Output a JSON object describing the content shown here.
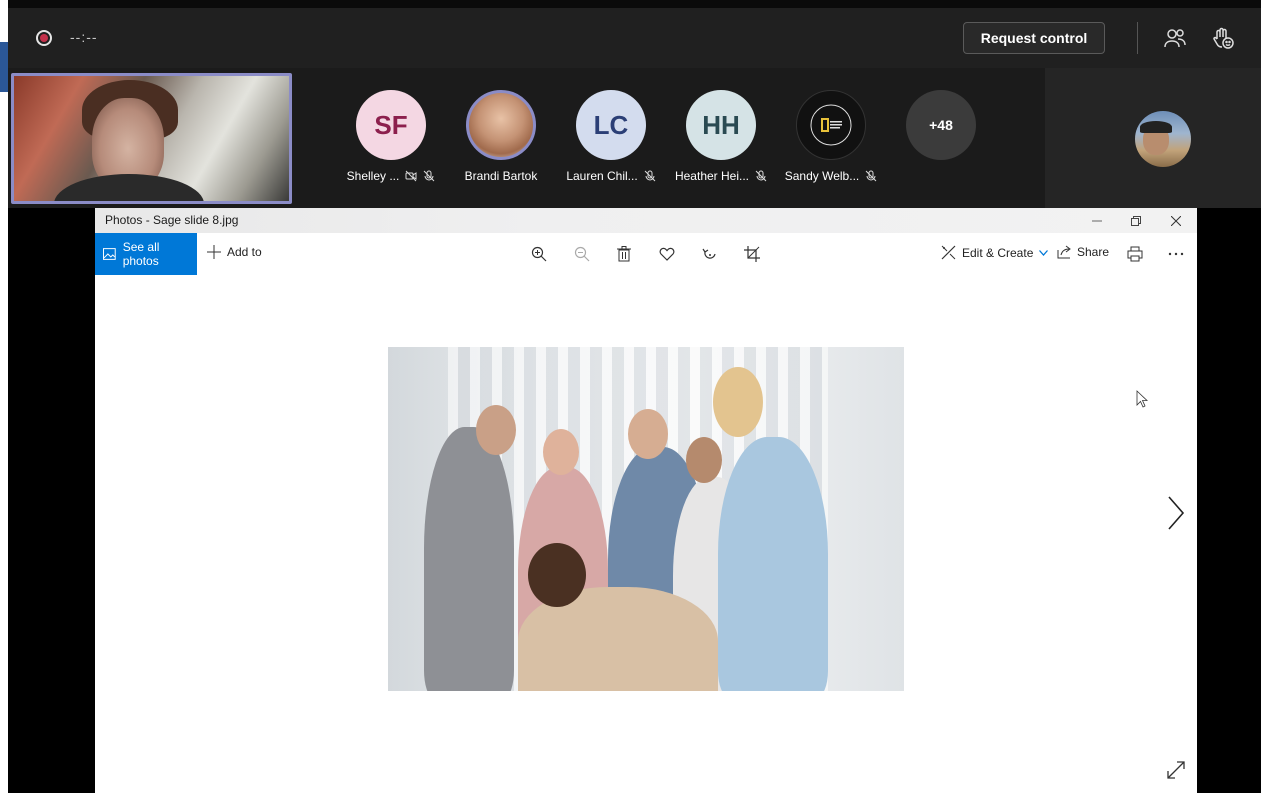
{
  "meeting": {
    "timer": "--:--",
    "request_control_label": "Request control",
    "participants": [
      {
        "initials": "SF",
        "name": "Shelley ...",
        "avatar_color": "#f4d7e3",
        "text_color": "#8c1f4d"
      },
      {
        "initials": "",
        "name": "Brandi Bartok",
        "avatar_color": "#c9a58a",
        "text_color": "#ffffff"
      },
      {
        "initials": "LC",
        "name": "Lauren Chil...",
        "avatar_color": "#d3dcee",
        "text_color": "#2b3f76"
      },
      {
        "initials": "HH",
        "name": "Heather Hei...",
        "avatar_color": "#d5e3e6",
        "text_color": "#2a4a52"
      },
      {
        "initials": "",
        "name": "Sandy Welb...",
        "avatar_color": "#111111",
        "text_color": "#ffffff"
      }
    ],
    "more_count": "+48"
  },
  "photos": {
    "window_title": "Photos - Sage slide 8.jpg",
    "see_all_label": "See all photos",
    "add_to_label": "Add to",
    "edit_create_label": "Edit & Create",
    "share_label": "Share",
    "accent_color": "#0078d7"
  }
}
